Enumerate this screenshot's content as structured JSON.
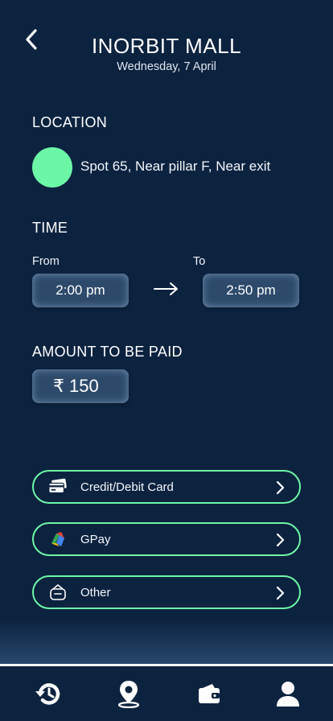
{
  "header": {
    "title": "INORBIT MALL",
    "date": "Wednesday, 7 April",
    "back_icon": "chevron-left-icon"
  },
  "location": {
    "label": "LOCATION",
    "spot": "Spot 65, Near pillar F, Near exit",
    "dot_color": "#6cf7a6"
  },
  "time": {
    "label": "TIME",
    "from_label": "From",
    "to_label": "To",
    "from_value": "2:00 pm",
    "to_value": "2:50 pm"
  },
  "amount": {
    "label": "AMOUNT TO BE PAID",
    "currency_symbol": "₹",
    "value": "150"
  },
  "payment_options": [
    {
      "label": "Credit/Debit Card",
      "icon": "credit-card-icon"
    },
    {
      "label": "GPay",
      "icon": "gpay-icon"
    },
    {
      "label": "Other",
      "icon": "wallet-other-icon"
    }
  ],
  "bottom_nav": [
    {
      "icon": "history-icon"
    },
    {
      "icon": "location-pin-icon"
    },
    {
      "icon": "wallet-icon"
    },
    {
      "icon": "profile-icon"
    }
  ],
  "colors": {
    "background": "#0c2340",
    "accent": "#6cf7a6",
    "pill": "#2d4a6b"
  }
}
